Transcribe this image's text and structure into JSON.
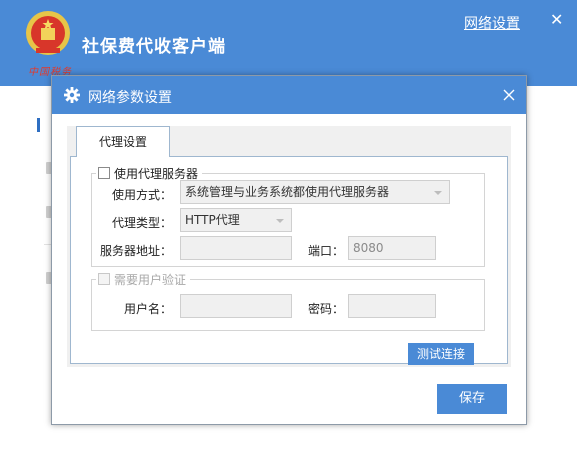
{
  "app": {
    "title": "社保费代收客户端",
    "network_settings_link": "网络设置",
    "close_glyph": "✕",
    "emblem_caption": "中国税务"
  },
  "dialog": {
    "title": "网络参数设置",
    "tab_label": "代理设置",
    "proxy_group": {
      "checkbox_label": "使用代理服务器",
      "checked": false,
      "usage_label": "使用方式：",
      "usage_value": "系统管理与业务系统都使用代理服务器",
      "type_label": "代理类型：",
      "type_value": "HTTP代理",
      "server_label": "服务器地址：",
      "server_value": "",
      "port_label": "端口：",
      "port_value": "8080"
    },
    "auth_group": {
      "checkbox_label": "需要用户验证",
      "checked": false,
      "username_label": "用户名：",
      "username_value": "",
      "password_label": "密码：",
      "password_value": ""
    },
    "test_button": "测试连接",
    "save_button": "保存"
  },
  "colors": {
    "primary": "#4a8ad6",
    "border": "#9fb7cf",
    "disabled_text": "#a8a8a8"
  },
  "icons": {
    "emblem": "tax-emblem-icon",
    "settings": "gear-icon",
    "close": "close-icon",
    "dropdown": "chevron-down-icon"
  }
}
